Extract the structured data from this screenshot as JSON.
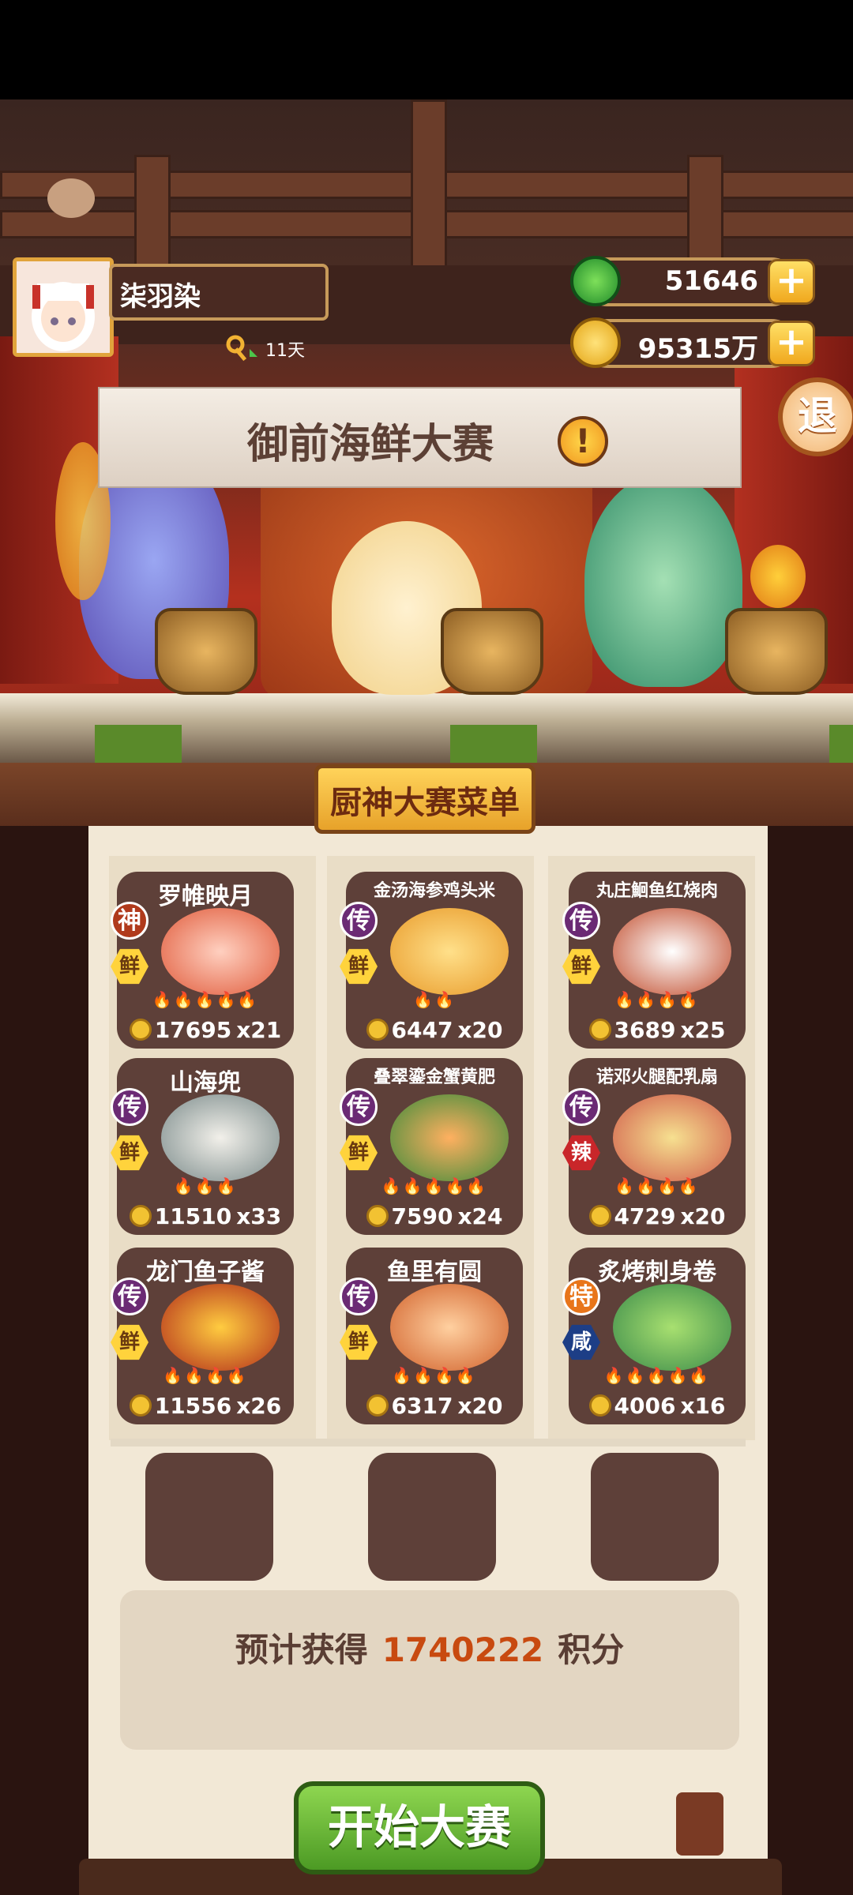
{
  "player": {
    "name": "柒羽染",
    "key_days": "11天"
  },
  "currency": {
    "jade": "51646",
    "coins": "95315万"
  },
  "exit_label": "退",
  "event_title": "御前海鲜大赛",
  "menu_title": "厨神大赛菜单",
  "dishes": [
    {
      "name": "罗帷映月",
      "rank": "神",
      "flavor": "鲜",
      "flames": 5,
      "price": "17695",
      "qty": "x21"
    },
    {
      "name": "金汤海参鸡头米",
      "rank": "传",
      "flavor": "鲜",
      "flames": 2,
      "price": "6447",
      "qty": "x20"
    },
    {
      "name": "丸庄鮰鱼红烧肉",
      "rank": "传",
      "flavor": "鲜",
      "flames": 4,
      "price": "3689",
      "qty": "x25"
    },
    {
      "name": "山海兜",
      "rank": "传",
      "flavor": "鲜",
      "flames": 3,
      "price": "11510",
      "qty": "x33"
    },
    {
      "name": "叠翠鎏金蟹黄肥",
      "rank": "传",
      "flavor": "鲜",
      "flames": 5,
      "price": "7590",
      "qty": "x24"
    },
    {
      "name": "诺邓火腿配乳扇",
      "rank": "传",
      "flavor": "辣",
      "flames": 4,
      "price": "4729",
      "qty": "x20"
    },
    {
      "name": "龙门鱼子酱",
      "rank": "传",
      "flavor": "鲜",
      "flames": 4,
      "price": "11556",
      "qty": "x26"
    },
    {
      "name": "鱼里有圆",
      "rank": "传",
      "flavor": "鲜",
      "flames": 4,
      "price": "6317",
      "qty": "x20"
    },
    {
      "name": "炙烤刺身卷",
      "rank": "特",
      "flavor": "咸",
      "flames": 5,
      "price": "4006",
      "qty": "x16"
    }
  ],
  "score": {
    "prefix": "预计获得",
    "value": "1740222",
    "suffix": "积分"
  },
  "start_button": "开始大赛"
}
